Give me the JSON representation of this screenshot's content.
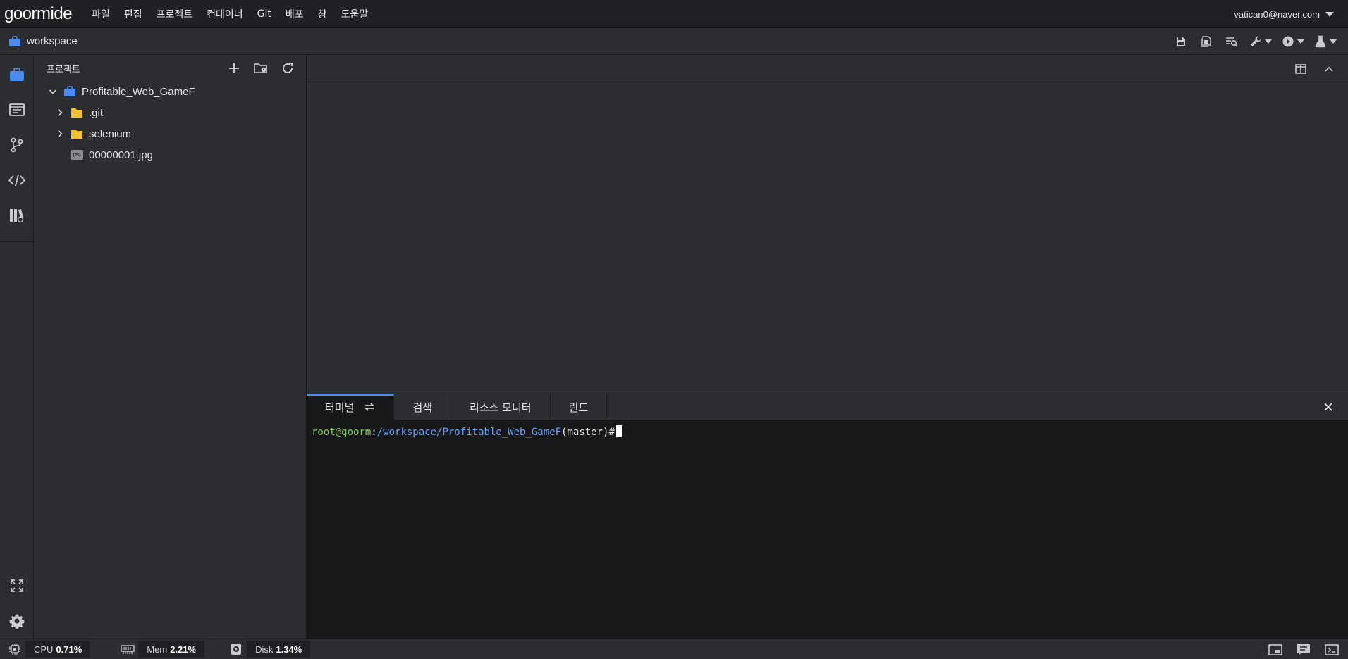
{
  "app": {
    "logo": "goormide",
    "user_email": "vatican0@naver.com"
  },
  "menu": [
    {
      "label": "파일"
    },
    {
      "label": "편집"
    },
    {
      "label": "프로젝트"
    },
    {
      "label": "컨테이너"
    },
    {
      "label": "Git"
    },
    {
      "label": "배포"
    },
    {
      "label": "창"
    },
    {
      "label": "도움말"
    }
  ],
  "workspace": {
    "name": "workspace"
  },
  "explorer": {
    "title": "프로젝트",
    "root": "Profitable_Web_GameF",
    "items": [
      {
        "label": ".git",
        "type": "folder"
      },
      {
        "label": "selenium",
        "type": "folder"
      },
      {
        "label": "00000001.jpg",
        "type": "file",
        "badge": "JPG"
      }
    ]
  },
  "panel": {
    "tabs": [
      {
        "label": "터미널"
      },
      {
        "label": "검색"
      },
      {
        "label": "리소스 모니터"
      },
      {
        "label": "린트"
      }
    ],
    "terminal": {
      "user_host": "root@goorm",
      "colon": ":",
      "path": "/workspace/Profitable_Web_GameF",
      "branch": "(master)#"
    }
  },
  "status": {
    "cpu_label": "CPU",
    "cpu_value": "0.71%",
    "mem_label": "Mem",
    "mem_value": "2.21%",
    "disk_label": "Disk",
    "disk_value": "1.34%"
  },
  "colors": {
    "accent": "#4a8cf0",
    "folder": "#f2c230",
    "terminal_green": "#7fc956",
    "terminal_blue": "#6c9ef8"
  }
}
